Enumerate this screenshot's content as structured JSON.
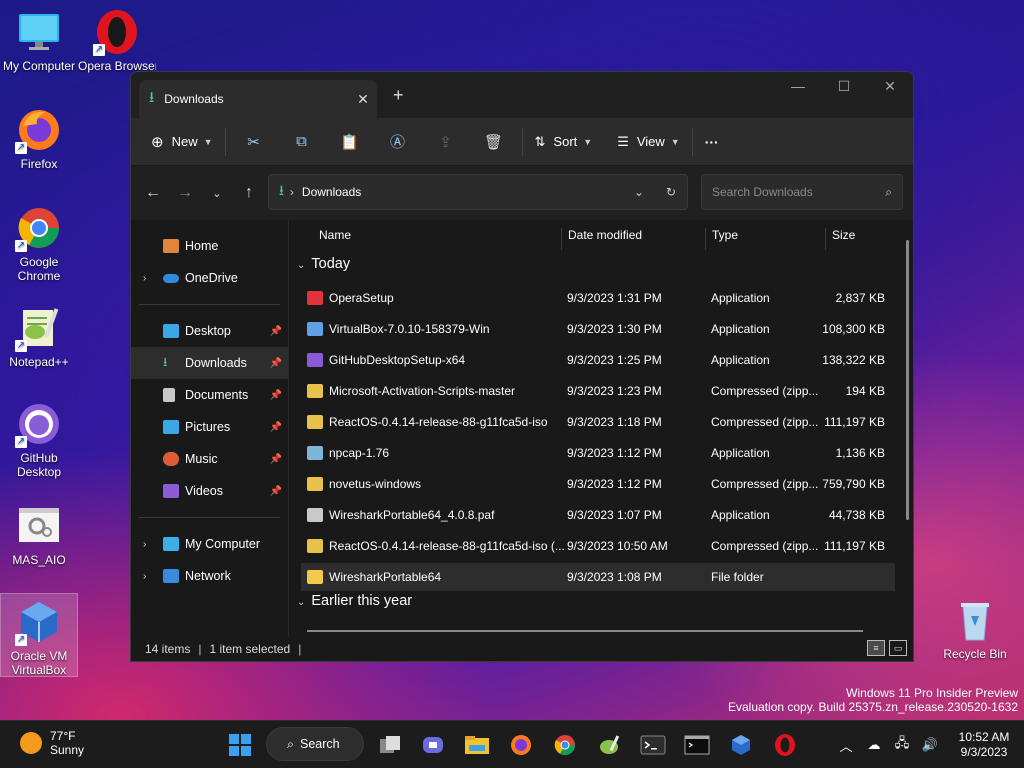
{
  "desktop": {
    "icons": [
      {
        "label": "My Computer"
      },
      {
        "label": "Opera Browser"
      },
      {
        "label": "Firefox"
      },
      {
        "label": "Google Chrome"
      },
      {
        "label": "Notepad++"
      },
      {
        "label": "GitHub Desktop"
      },
      {
        "label": "MAS_AIO"
      },
      {
        "label": "Oracle VM VirtualBox"
      },
      {
        "label": "Recycle Bin"
      }
    ]
  },
  "window": {
    "tab_title": "Downloads",
    "new_tab": "+",
    "toolbar": {
      "new_label": "New",
      "sort_label": "Sort",
      "view_label": "View",
      "more_label": "···"
    },
    "address": {
      "path": "Downloads",
      "search_placeholder": "Search Downloads"
    },
    "sidebar": {
      "home": "Home",
      "onedrive": "OneDrive",
      "desktop": "Desktop",
      "downloads": "Downloads",
      "documents": "Documents",
      "pictures": "Pictures",
      "music": "Music",
      "videos": "Videos",
      "mycomputer": "My Computer",
      "network": "Network"
    },
    "columns": {
      "name": "Name",
      "date": "Date modified",
      "type": "Type",
      "size": "Size"
    },
    "groups": {
      "today": "Today",
      "earlier": "Earlier this year"
    },
    "files": [
      {
        "name": "OperaSetup",
        "date": "9/3/2023 1:31 PM",
        "type": "Application",
        "size": "2,837 KB",
        "icon_color": "#e0333a"
      },
      {
        "name": "VirtualBox-7.0.10-158379-Win",
        "date": "9/3/2023 1:30 PM",
        "type": "Application",
        "size": "108,300 KB",
        "icon_color": "#5fa0e8"
      },
      {
        "name": "GitHubDesktopSetup-x64",
        "date": "9/3/2023 1:25 PM",
        "type": "Application",
        "size": "138,322 KB",
        "icon_color": "#8a5cd8"
      },
      {
        "name": "Microsoft-Activation-Scripts-master",
        "date": "9/3/2023 1:23 PM",
        "type": "Compressed (zipp...",
        "size": "194 KB",
        "icon_color": "#e8c14a"
      },
      {
        "name": "ReactOS-0.4.14-release-88-g11fca5d-iso",
        "date": "9/3/2023 1:18 PM",
        "type": "Compressed (zipp...",
        "size": "111,197 KB",
        "icon_color": "#e8c14a"
      },
      {
        "name": "npcap-1.76",
        "date": "9/3/2023 1:12 PM",
        "type": "Application",
        "size": "1,136 KB",
        "icon_color": "#7fb6d8"
      },
      {
        "name": "novetus-windows",
        "date": "9/3/2023 1:12 PM",
        "type": "Compressed (zipp...",
        "size": "759,790 KB",
        "icon_color": "#e8c14a"
      },
      {
        "name": "WiresharkPortable64_4.0.8.paf",
        "date": "9/3/2023 1:07 PM",
        "type": "Application",
        "size": "44,738 KB",
        "icon_color": "#c9c9c9"
      },
      {
        "name": "ReactOS-0.4.14-release-88-g11fca5d-iso (...",
        "date": "9/3/2023 10:50 AM",
        "type": "Compressed (zipp...",
        "size": "111,197 KB",
        "icon_color": "#e8c14a"
      },
      {
        "name": "WiresharkPortable64",
        "date": "9/3/2023 1:08 PM",
        "type": "File folder",
        "size": "",
        "icon_color": "#f2c94c"
      }
    ],
    "status": {
      "items": "14 items",
      "selected": "1 item selected"
    }
  },
  "watermark": {
    "line1": "Windows 11 Pro Insider Preview",
    "line2": "Evaluation copy. Build 25375.zn_release.230520-1632"
  },
  "taskbar": {
    "weather_temp": "77°F",
    "weather_desc": "Sunny",
    "search_label": "Search",
    "time": "10:52 AM",
    "date": "9/3/2023"
  }
}
